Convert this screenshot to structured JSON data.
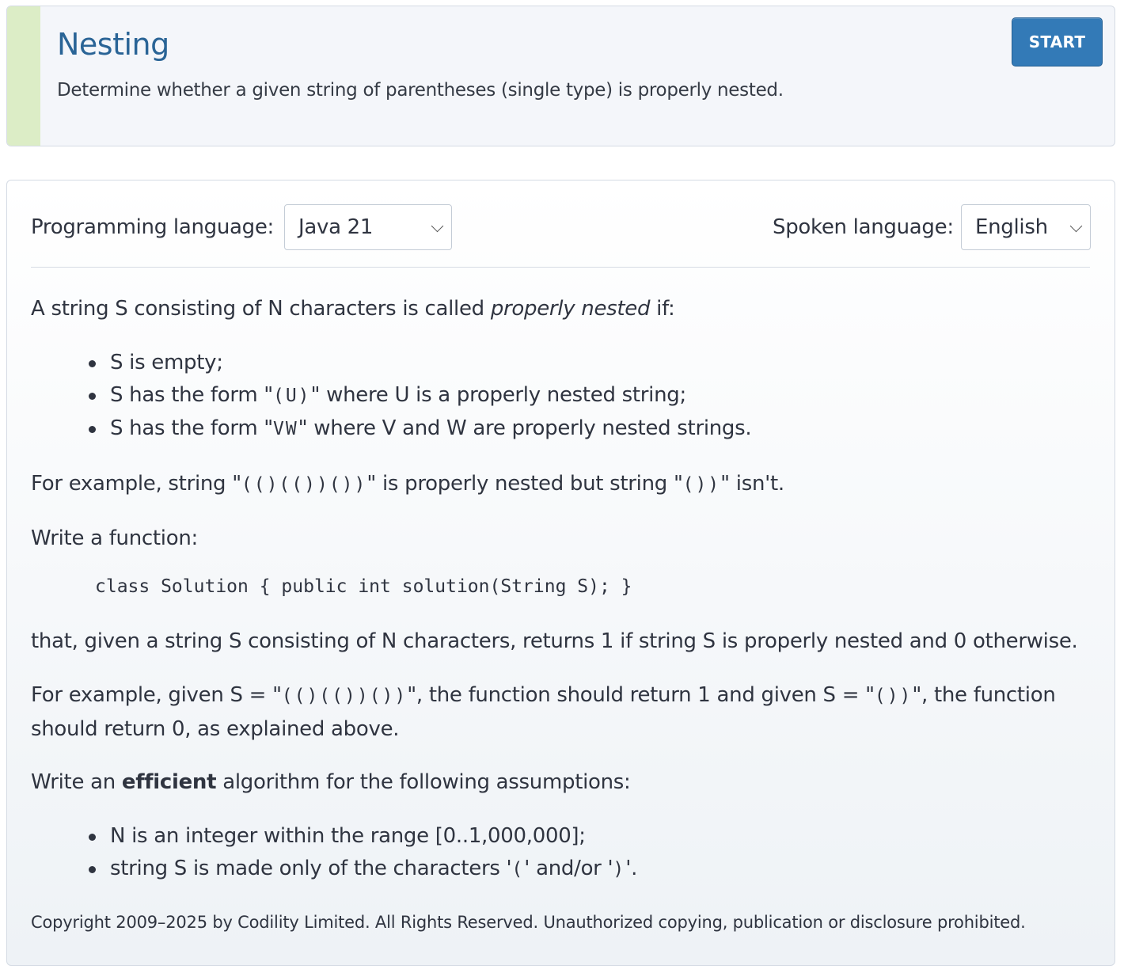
{
  "header": {
    "title": "Nesting",
    "description": "Determine whether a given string of parentheses (single type) is properly nested.",
    "start_label": "START",
    "accent_color": "#dcedc6",
    "title_color": "#2a6496",
    "button_color": "#337ab7"
  },
  "languages": {
    "programming_label": "Programming language:",
    "programming_value": "Java 21",
    "spoken_label": "Spoken language:",
    "spoken_value": "English"
  },
  "task": {
    "intro_a": "A string S consisting of N characters is called ",
    "intro_em": "properly nested",
    "intro_b": " if:",
    "rules": [
      {
        "a": "S is empty;",
        "code": "",
        "b": ""
      },
      {
        "a": "S has the form \"",
        "code": "(U)",
        "b": "\" where U is a properly nested string;"
      },
      {
        "a": "S has the form \"",
        "code": "VW",
        "b": "\" where V and W are properly nested strings."
      }
    ],
    "example_a": "For example, string \"",
    "example_code1": "(()(())())",
    "example_b": "\" is properly nested but string \"",
    "example_code2": "())",
    "example_c": "\" isn't.",
    "write_function": "Write a function:",
    "signature": "class Solution { public int solution(String S); }",
    "returns": "that, given a string S consisting of N characters, returns 1 if string S is properly nested and 0 otherwise.",
    "given_a": "For example, given S = \"",
    "given_code1": "(()(())())",
    "given_b": "\", the function should return 1 and given S = \"",
    "given_code2": "())",
    "given_c": "\", the function",
    "given_line2": "should return 0, as explained above.",
    "efficient_a": "Write an ",
    "efficient_strong": "efficient",
    "efficient_b": " algorithm for the following assumptions:",
    "assumptions": [
      {
        "a": "N is an integer within the range [0..1,000,000];",
        "c1": "",
        "m": "",
        "c2": "",
        "b": ""
      },
      {
        "a": "string S is made only of the characters '",
        "c1": "(",
        "m": "' and/or '",
        "c2": ")",
        "b": "'."
      }
    ]
  },
  "footer": {
    "copyright": "Copyright 2009–2025 by Codility Limited. All Rights Reserved. Unauthorized copying, publication or disclosure prohibited."
  }
}
